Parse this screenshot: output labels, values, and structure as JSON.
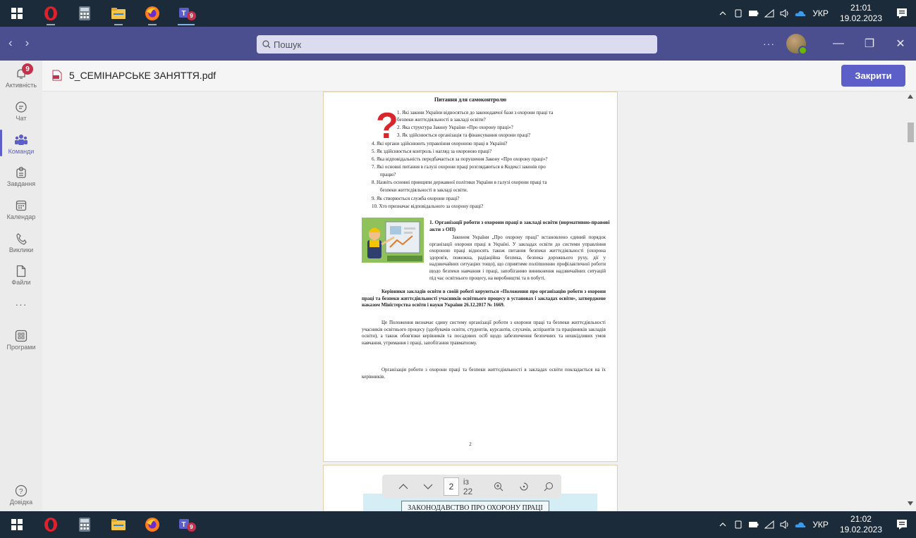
{
  "taskbar_top": {
    "lang": "УКР",
    "time": "21:01",
    "date": "19.02.2023",
    "teams_badge": "9"
  },
  "taskbar_bottom": {
    "lang": "УКР",
    "time": "21:02",
    "date": "19.02.2023",
    "teams_badge": "9"
  },
  "titlebar": {
    "search_placeholder": "Пошук",
    "more": "···"
  },
  "rail": {
    "activity_badge": "9",
    "items": [
      {
        "label": "Активність",
        "icon": "bell-icon"
      },
      {
        "label": "Чат",
        "icon": "chat-icon"
      },
      {
        "label": "Команди",
        "icon": "teams-icon"
      },
      {
        "label": "Завдання",
        "icon": "tasks-icon"
      },
      {
        "label": "Календар",
        "icon": "calendar-icon"
      },
      {
        "label": "Виклики",
        "icon": "phone-icon"
      },
      {
        "label": "Файли",
        "icon": "file-icon"
      },
      {
        "label": "Програми",
        "icon": "apps-icon"
      },
      {
        "label": "Довідка",
        "icon": "help-icon"
      }
    ],
    "more": "···"
  },
  "file": {
    "name": "5_СЕМІНАРСЬКЕ ЗАНЯТТЯ.pdf",
    "close_label": "Закрити"
  },
  "document": {
    "title": "Питання для самоконтролю",
    "questions": [
      "1.       Які закони України відносяться до законодавчої бази з охорони праці та",
      "безпеки життєдіяльності в закладі освіти?",
      "2.       Яка структура Закону України «Про охорону праці»?",
      "3.       Як здійснюється організація та фінансування охорони праці?",
      "4.  Які органи здійснюють управління охороною праці в Україні?",
      "5.  Як здійснюється контроль і нагляд за охороною праці?",
      "6.  Яка відповідальність передбачається за порушення Закону «Про охорону праці»?",
      "7.  Які основні питання в галузі охорони праці розглядаються в Кодексі законів про",
      "працю?",
      "8.  Назвіть основні принципи державної політики України в галузі охорони праці та",
      "безпеки життєдіяльності в закладі освіти.",
      "9.  Як створюється служба охорони праці?",
      "10. Хто призначає відповідального за охорону праці?"
    ],
    "section_title": "1. Організації роботи з охорони  праці в закладі освіти (нормативно-правові акти з ОП)",
    "para1": "Законом України „Про охорону праці\" встановлено єдиний порядок організації охорони праці в Україні.  У закладах освіти до системи управління охороною праці відносять також  питання безпеки життєдіяльності (охорона здоров'я, пожежна, радіаційна безпека, безпека дорожнього руху, дії у надзвичайних ситуаціях тощо), що сприятиме поліпшенню профілактичної роботи щодо безпеки навчання і праці, запобіганню виникнення надзвичайних ситуацій під час освітнього процесу, на виробництві та в побуті.",
    "para2": "Керівники закладів освіти в своїй роботі керуються «Положення про організацію роботи з охорони праці та безпеки життєдіяльності учасників освітнього процесу в установах і закладах освіти», затверджене наказом Міністерства освіти і науки України 26.12.2017 № 1669.",
    "para3": "Це Положення визначає єдину систему організації роботи з охорони праці та безпеки життєдіяльності учасників освітнього процесу (здобувачів освіти, студентів, курсантів, слухачів, аспірантів та працівників закладів освіти), а також обов'язки керівників та посадових осіб щодо забезпечення безпечних та нешкідливих умов навчання, утримання і праці, запобігання травматизму.",
    "para4": "Організація роботи з охорони праці та безпеки життєдіяльності в закладах освіти покладається на їх керівників.",
    "page_number": "2",
    "next_page_heading": "ЗАКОНОДАВСТВО ПРО ОХОРОНУ ПРАЦІ"
  },
  "toolbar": {
    "current_page": "2",
    "total": "із 22"
  }
}
